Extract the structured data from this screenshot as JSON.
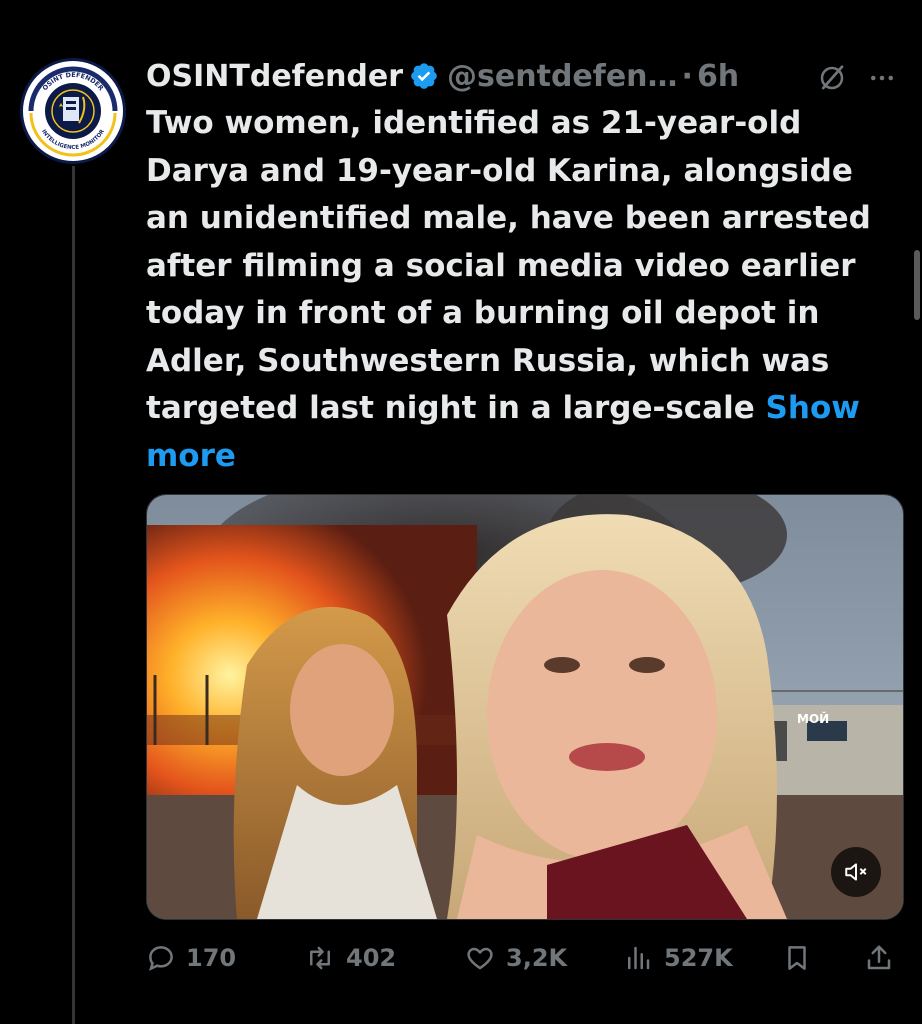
{
  "tweet": {
    "author_name": "OSINTdefender",
    "handle": "@sentdefen…",
    "separator": "·",
    "time": "6h",
    "avatar_text_top": "OSINT DEFENDER",
    "avatar_text_bottom": "INTELLIGENCE MONITOR",
    "text": "Two women, identified as 21-year-old Darya and 19-year-old Karina, alongside an unidentified male, have been arrested after filming a social media video earlier today in front of a burning oil depot in Adler, Southwestern Russia, which was targeted last night in a large-scale ",
    "show_more": "Show more"
  },
  "media": {
    "type": "video",
    "sign_text": "МОЙ"
  },
  "actions": {
    "replies": "170",
    "reposts": "402",
    "likes": "3,2K",
    "views": "527K"
  },
  "icons": {
    "verified": "verified-badge-icon",
    "grok": "grok-icon",
    "more": "more-options-icon",
    "mute": "volume-muted-icon",
    "reply": "reply-icon",
    "repost": "repost-icon",
    "like": "heart-icon",
    "views": "views-icon",
    "bookmark": "bookmark-icon",
    "share": "share-icon"
  },
  "colors": {
    "background": "#000000",
    "text": "#e7e9ea",
    "secondary": "#71767b",
    "link": "#1d9bf0"
  }
}
